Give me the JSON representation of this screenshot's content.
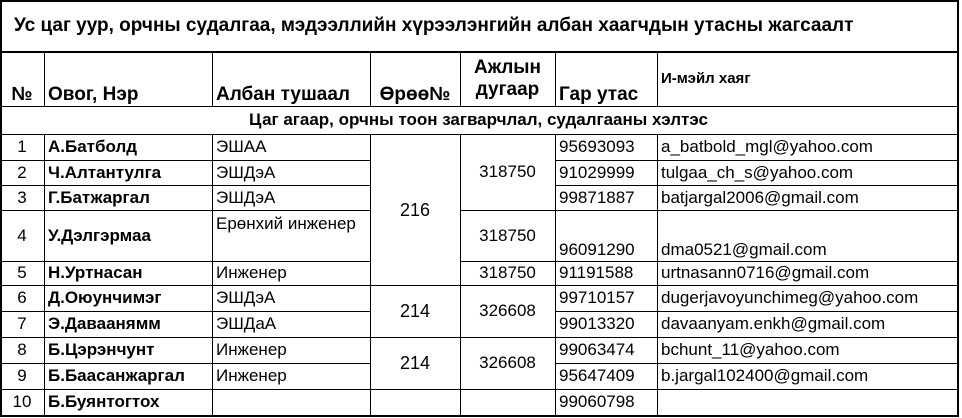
{
  "title": "Ус цаг уур, орчны судалгаа, мэдээллийн хүрээлэнгийн албан хаагчдын утасны жагсаалт",
  "headers": {
    "num": "№",
    "name": "Овог, Нэр",
    "position": "Албан тушаал",
    "room": "Өрөө№",
    "work_phone": "Ажлын дугаар",
    "mobile": "Гар утас",
    "email": "И-мэйл хаяг"
  },
  "section": "Цаг агаар, орчны тоон загварчлал, судалгааны хэлтэс",
  "rows": [
    {
      "num": "1",
      "name": "А.Батболд",
      "position": "ЭШАА",
      "mobile": "95693093",
      "email": "a_batbold_mgl@yahoo.com"
    },
    {
      "num": "2",
      "name": "Ч.Алтантулга",
      "position": "ЭШДэА",
      "mobile": "91029999",
      "email": "tulgaa_ch_s@yahoo.com"
    },
    {
      "num": "3",
      "name": "Г.Батжаргал",
      "position": "ЭШДэА",
      "mobile": "99871887",
      "email": "batjargal2006@gmail.com"
    },
    {
      "num": "4",
      "name": "У.Дэлгэрмаа",
      "position": "Ерөнхий инженер",
      "mobile": "96091290",
      "email": "dma0521@gmail.com"
    },
    {
      "num": "5",
      "name": "Н.Уртнасан",
      "position": "Инженер",
      "mobile": "91191588",
      "email": "urtnasann0716@gmail.com"
    },
    {
      "num": "6",
      "name": "Д.Оюунчимэг",
      "position": "ЭШДэА",
      "mobile": "99710157",
      "email": "dugerjavoyunchimeg@yahoo.com"
    },
    {
      "num": "7",
      "name": "Э.Даваанямм",
      "position": "ЭШДаА",
      "mobile": "99013320",
      "email": "davaanyam.enkh@gmail.com"
    },
    {
      "num": "8",
      "name": "Б.Цэрэнчунт",
      "position": "Инженер",
      "mobile": "99063474",
      "email": "bchunt_11@yahoo.com"
    },
    {
      "num": "9",
      "name": "Б.Баасанжаргал",
      "position": "Инженер",
      "mobile": "95647409",
      "email": "b.jargal102400@gmail.com"
    },
    {
      "num": "10",
      "name": "Б.Буянтогтох",
      "position": "",
      "mobile": "99060798",
      "email": ""
    }
  ],
  "merged": {
    "room_1_5": "216",
    "work_1_3": "318750",
    "work_4": "318750",
    "work_5": "318750",
    "room_6_7": "214",
    "work_6_7": "326608",
    "room_8_9": "214",
    "work_8_9": "326608"
  }
}
